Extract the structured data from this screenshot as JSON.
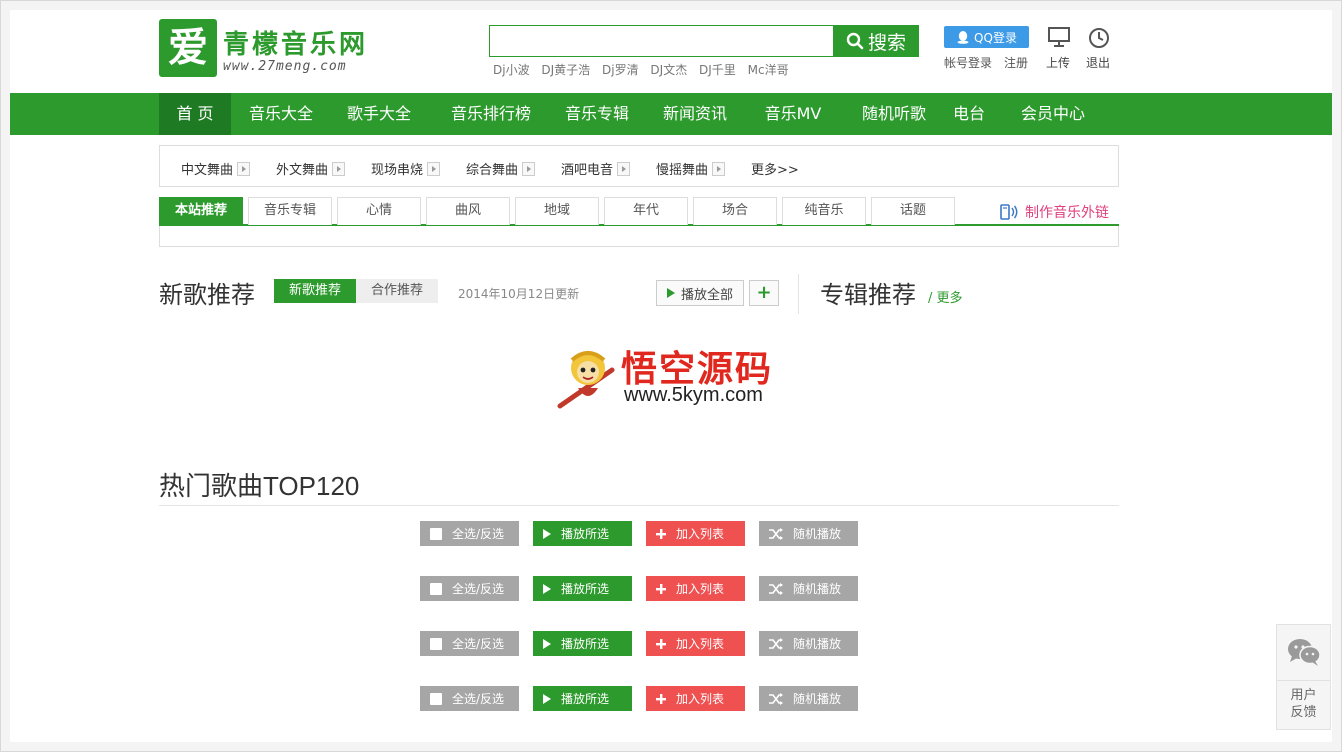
{
  "header": {
    "logo_char": "爱",
    "logo_title": "青檬音乐网",
    "logo_url": "www.27meng.com",
    "search": {
      "placeholder": "",
      "button_label": "搜索"
    },
    "hotwords": [
      "Dj小波",
      "DJ黄子浩",
      "Dj罗清",
      "DJ文杰",
      "DJ千里",
      "Mc洋哥"
    ],
    "qq_login": "QQ登录",
    "account_login": "帐号登录",
    "register": "注册",
    "upload": "上传",
    "logout": "退出"
  },
  "nav": {
    "items": [
      "首 页",
      "音乐大全",
      "歌手大全",
      "音乐排行榜",
      "音乐专辑",
      "新闻资讯",
      "音乐MV",
      "随机听歌",
      "电台",
      "会员中心"
    ],
    "active_index": 0
  },
  "categories": {
    "items": [
      "中文舞曲",
      "外文舞曲",
      "现场串烧",
      "综合舞曲",
      "酒吧电音",
      "慢摇舞曲"
    ],
    "more": "更多>>"
  },
  "tabs": {
    "items": [
      "本站推荐",
      "音乐专辑",
      "心情",
      "曲风",
      "地域",
      "年代",
      "场合",
      "纯音乐",
      "话题"
    ],
    "active_index": 0,
    "external_link": "制作音乐外链"
  },
  "new_songs": {
    "title": "新歌推荐",
    "pill_on": "新歌推荐",
    "pill_off": "合作推荐",
    "updated": "2014年10月12日更新",
    "play_all": "播放全部",
    "add": "+"
  },
  "albums": {
    "title": "专辑推荐",
    "more": "/ 更多"
  },
  "watermark": {
    "text": "悟空源码",
    "url": "www.5kym.com"
  },
  "hot": {
    "title": "热门歌曲TOP120",
    "rows": [
      {
        "select": "全选/反选",
        "play": "播放所选",
        "add": "加入列表",
        "random": "随机播放"
      },
      {
        "select": "全选/反选",
        "play": "播放所选",
        "add": "加入列表",
        "random": "随机播放"
      },
      {
        "select": "全选/反选",
        "play": "播放所选",
        "add": "加入列表",
        "random": "随机播放"
      },
      {
        "select": "全选/反选",
        "play": "播放所选",
        "add": "加入列表",
        "random": "随机播放"
      }
    ]
  },
  "feedback": {
    "label_line1": "用户",
    "label_line2": "反馈"
  },
  "colors": {
    "brand_green": "#2d9a2d",
    "nav_active": "#1f7a24",
    "qq_blue": "#3c9ae6",
    "add_red": "#ef5050",
    "link_pink": "#e0407f"
  }
}
